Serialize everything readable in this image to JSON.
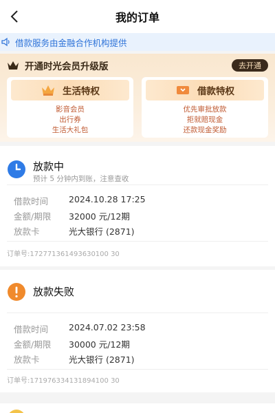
{
  "nav": {
    "title": "我的订单"
  },
  "notice": {
    "text": "借款服务由金融合作机构提供"
  },
  "vip": {
    "title": "开通时光会员升级版",
    "open_label": "去开通",
    "cards": [
      {
        "title": "生活特权",
        "lines": [
          "影音会员",
          "出行券",
          "生活大礼包"
        ]
      },
      {
        "title": "借款特权",
        "lines": [
          "优先审批放款",
          "拒就赔现金",
          "还款现金奖励"
        ]
      }
    ]
  },
  "orders": [
    {
      "status": "放款中",
      "status_sub": "预计 5 分钟内到账，注意查收",
      "rows": [
        {
          "label": "借款时间",
          "value": "2024.10.28 17:25"
        },
        {
          "label": "金额/期限",
          "value": "32000 元/12期"
        },
        {
          "label": "放款卡",
          "value": "光大银行 (2871)"
        }
      ],
      "order_no": "订单号:172771361493630100 30"
    },
    {
      "status": "放款失败",
      "rows": [
        {
          "label": "借款时间",
          "value": "2024.07.02 23:58"
        },
        {
          "label": "金额/期限",
          "value": "30000 元/12期"
        },
        {
          "label": "放款卡",
          "value": "光大银行 (2871)"
        }
      ],
      "order_no": "订单号:171976334131894100 30"
    }
  ],
  "colors": {
    "accent_blue": "#2f74d9",
    "warning_orange": "#f08a2c",
    "vip_text": "#c05a32"
  }
}
